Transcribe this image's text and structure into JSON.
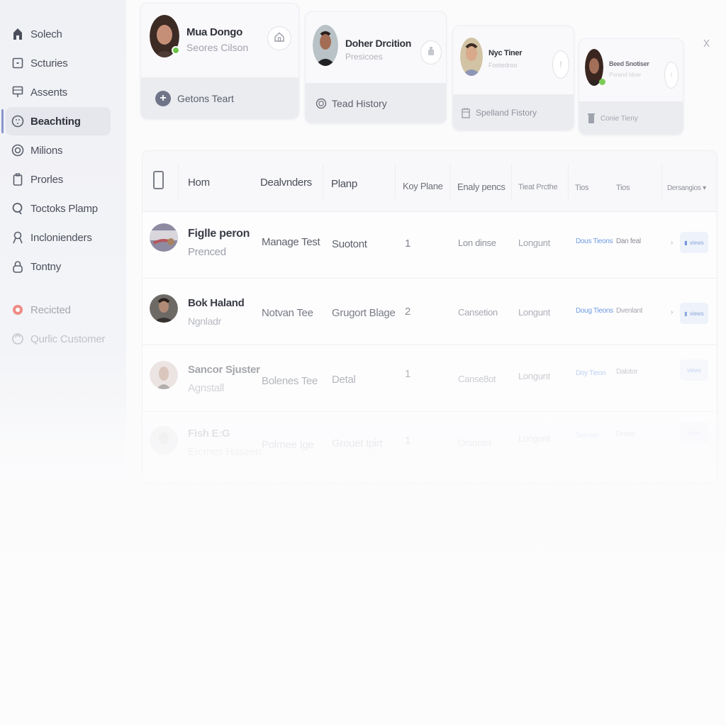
{
  "sidebar": {
    "items": [
      {
        "label": "Solech",
        "icon": "home-icon"
      },
      {
        "label": "Scturies",
        "icon": "square-icon"
      },
      {
        "label": "Assents",
        "icon": "monitor-icon"
      },
      {
        "label": "Beachting",
        "icon": "face-circle-icon",
        "active": true
      },
      {
        "label": "Milions",
        "icon": "target-icon"
      },
      {
        "label": "Prorles",
        "icon": "clipboard-icon"
      },
      {
        "label": "Toctoks Plamp",
        "icon": "search-icon"
      },
      {
        "label": "Inclonienders",
        "icon": "person-icon"
      },
      {
        "label": "Tontny",
        "icon": "lock-icon"
      }
    ],
    "secondary": [
      {
        "label": "Recicted",
        "icon": "record-icon"
      },
      {
        "label": "Qurlic Customer",
        "icon": "customer-icon"
      }
    ]
  },
  "cards": [
    {
      "name": "Mua Dongo",
      "subtitle": "Seores Cilson",
      "action_icon": "home-icon",
      "footer_label": "Getons Teart",
      "footer_icon": "plus-icon",
      "online": true
    },
    {
      "name": "Doher Drcition",
      "subtitle": "Presicoes",
      "action_icon": "bottle-icon",
      "footer_label": "Tead History",
      "footer_icon": "history-icon",
      "online": false
    },
    {
      "name": "Nyc Tiner",
      "subtitle": "Fostedroo",
      "action_icon": "info-icon",
      "footer_label": "Spelland Fistory",
      "footer_icon": "calendar-icon",
      "online": false
    },
    {
      "name": "Beed Snotiser",
      "subtitle": "Porand Idow",
      "action_icon": "info-icon",
      "footer_label": "Conie Tieny",
      "footer_icon": "trash-icon",
      "online": true
    }
  ],
  "close_label": "x",
  "table": {
    "columns": [
      "Hom",
      "Dealvnders",
      "Planp",
      "Koy Plane",
      "Enaly pencs",
      "Tieat Prcthe",
      "Tios",
      "Tios",
      "Dersangios"
    ],
    "sort_chevron": "▾",
    "rows": [
      {
        "name": "Figlle peron",
        "sub": "Prenced",
        "col2": "Manage Test",
        "col3": "Suotont",
        "num": "1",
        "c5": "Lon dinse",
        "c6": "Longunt",
        "link": "Dous Tieons",
        "c8": "Dan feal",
        "action": "views"
      },
      {
        "name": "Bok Haland",
        "sub": "Ngnladr",
        "col2": "Notvan Tee",
        "col3": "Grugort Blage",
        "num": "2",
        "c5": "Cansetion",
        "c6": "Longunt",
        "link": "Doug Tieons",
        "c8": "Dvenlant",
        "action": "views"
      },
      {
        "name": "Sancor Sjuster",
        "sub": "Agnstall",
        "col2": "Bolenes Tee",
        "col3": "Detal",
        "num": "1",
        "c5": "Canse8ot",
        "c6": "Longunt",
        "link": "Doy Tieon",
        "c8": "Dalotor",
        "action": "views"
      },
      {
        "name": "Fish E:G",
        "sub": "Ercrnes Haseen",
        "col2": "Polrnee Ige",
        "col3": "Grouet Ipirt",
        "num": "1",
        "c5": "Orsnotel",
        "c6": "Longunt",
        "link": "Sernsel",
        "c8": "Drows",
        "action": "views"
      }
    ]
  }
}
